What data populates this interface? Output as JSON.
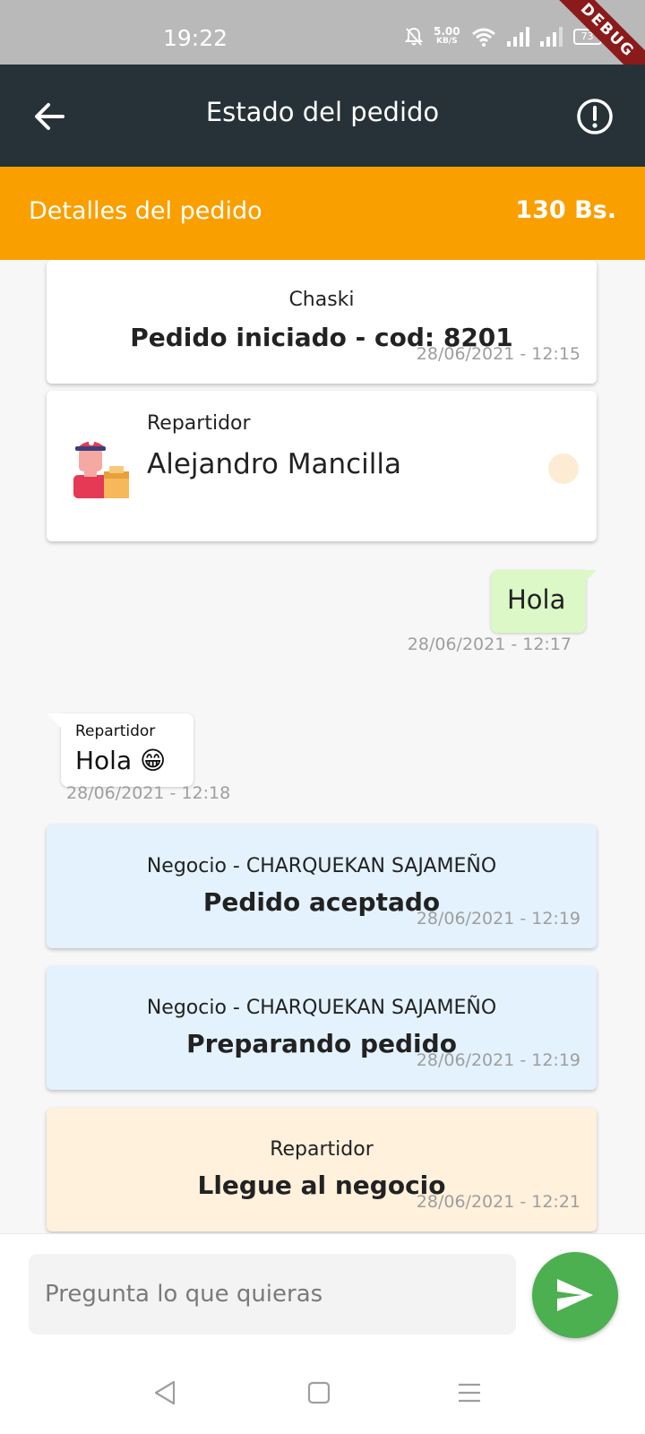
{
  "status_bar": {
    "time": "19:22",
    "net_speed": "5.00",
    "net_unit": "KB/S",
    "battery": "73",
    "debug_banner": "DEBUG"
  },
  "app_bar": {
    "title": "Estado del pedido",
    "back_icon": "arrow-left-icon",
    "info_icon": "alert-circle-icon"
  },
  "order_bar": {
    "label": "Detalles del pedido",
    "total": "130 Bs."
  },
  "messages": {
    "started": {
      "who": "Chaski",
      "what": "Pedido iniciado - cod: 8201",
      "time": "28/06/2021 - 12:15"
    },
    "driver": {
      "role": "Repartidor",
      "name": "Alejandro Mancilla"
    },
    "outgoing": {
      "text": "Hola",
      "time": "28/06/2021 - 12:17"
    },
    "incoming": {
      "sender": "Repartidor",
      "text": "Hola 😁",
      "time": "28/06/2021 - 12:18"
    },
    "accepted": {
      "who": "Negocio - CHARQUEKAN SAJAMEÑO",
      "what": "Pedido aceptado",
      "time": "28/06/2021 - 12:19"
    },
    "preparing": {
      "who": "Negocio - CHARQUEKAN SAJAMEÑO",
      "what": "Preparando pedido",
      "time": "28/06/2021 - 12:19"
    },
    "arrived": {
      "who": "Repartidor",
      "what": "Llegue al negocio",
      "time": "28/06/2021 - 12:21"
    }
  },
  "composer": {
    "placeholder": "Pregunta lo que quieras",
    "send_icon": "send-icon"
  },
  "colors": {
    "app_bar": "#263238",
    "order_bar": "#fa9f00",
    "business_card": "#e3f2fd",
    "driver_card": "#fff1dc",
    "outgoing_bubble": "#dcf8c6",
    "send_button": "#4caf50"
  }
}
